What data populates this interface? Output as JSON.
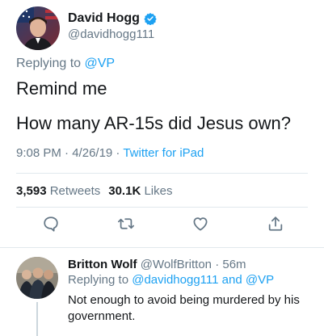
{
  "main_tweet": {
    "display_name": "David Hogg",
    "handle": "@davidhogg111",
    "replying_prefix": "Replying to ",
    "replying_mention": "@VP",
    "text_lines": [
      "Remind me",
      "How many AR-15s did Jesus own?"
    ],
    "time": "9:08 PM",
    "separator": " · ",
    "date": "4/26/19",
    "source": "Twitter for iPad",
    "retweets_count": "3,593",
    "retweets_label": " Retweets",
    "likes_count": "30.1K",
    "likes_label": " Likes"
  },
  "actions": {
    "reply_icon": "speech-bubble-icon",
    "retweet_icon": "retweet-icon",
    "like_icon": "heart-icon",
    "share_icon": "share-icon"
  },
  "reply_tweet": {
    "display_name": "Britton Wolf",
    "handle": "@WolfBritton",
    "separator": " · ",
    "time": "56m",
    "replying_prefix": "Replying to ",
    "replying_mentions": "@davidhogg111 and @VP",
    "text": "Not enough to avoid being murdered by his government."
  },
  "colors": {
    "accent": "#1da1f2",
    "secondary_text": "#657786",
    "primary_text": "#14171a",
    "divider": "#e1e8ed"
  }
}
